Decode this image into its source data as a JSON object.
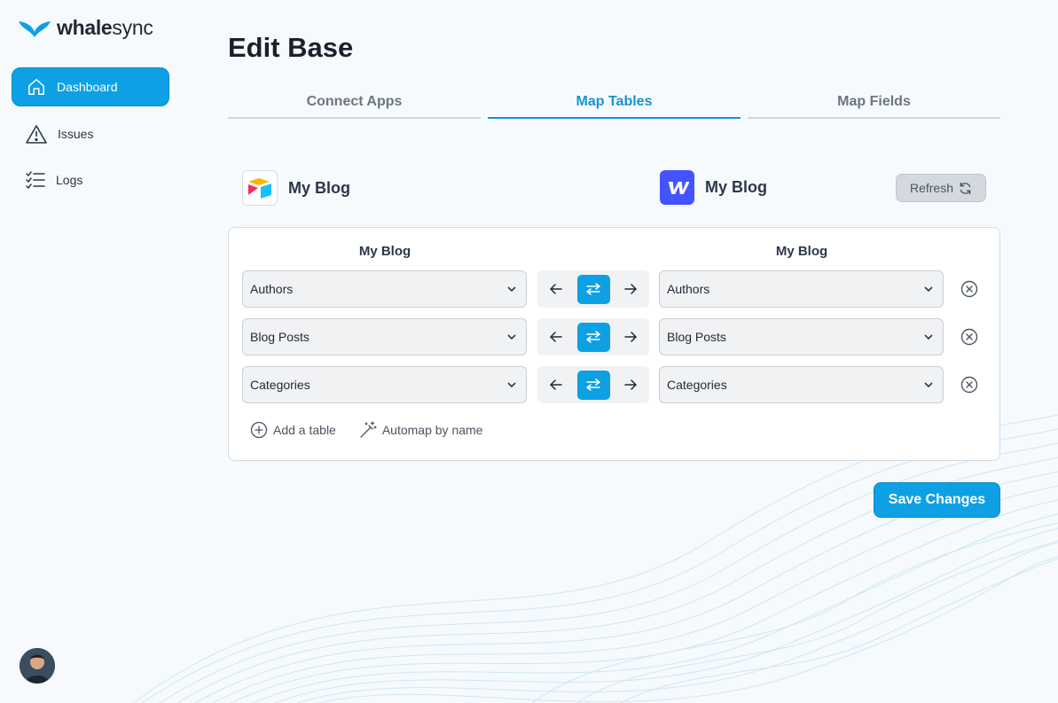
{
  "brand": {
    "name_bold": "whale",
    "name_light": "sync",
    "color": "#0ea0e4"
  },
  "sidebar": {
    "items": [
      {
        "label": "Dashboard",
        "icon": "home-icon",
        "active": true
      },
      {
        "label": "Issues",
        "icon": "warning-icon",
        "active": false
      },
      {
        "label": "Logs",
        "icon": "list-check-icon",
        "active": false
      }
    ]
  },
  "page": {
    "title": "Edit Base"
  },
  "tabs": [
    {
      "label": "Connect Apps",
      "active": false
    },
    {
      "label": "Map Tables",
      "active": true
    },
    {
      "label": "Map Fields",
      "active": false
    }
  ],
  "apps": {
    "left": {
      "name": "My Blog",
      "icon": "airtable-logo"
    },
    "right": {
      "name": "My Blog",
      "icon": "webflow-logo"
    }
  },
  "refresh": {
    "label": "Refresh"
  },
  "mapping": {
    "left_header": "My Blog",
    "right_header": "My Blog",
    "rows": [
      {
        "left": "Authors",
        "right": "Authors",
        "direction": "both"
      },
      {
        "left": "Blog Posts",
        "right": "Blog Posts",
        "direction": "both"
      },
      {
        "left": "Categories",
        "right": "Categories",
        "direction": "both"
      }
    ],
    "add_table": "Add a table",
    "automap": "Automap by name"
  },
  "save": {
    "label": "Save Changes"
  }
}
